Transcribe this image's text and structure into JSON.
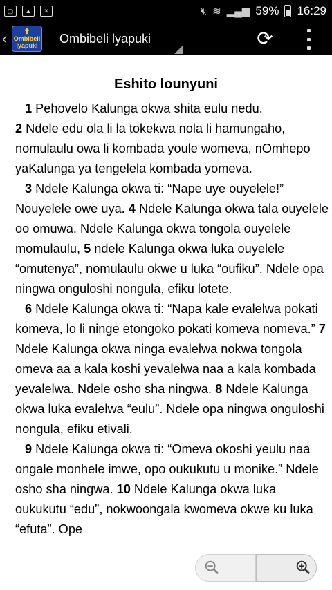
{
  "status_bar": {
    "battery": "59%",
    "time": "16:29"
  },
  "app_bar": {
    "logo_line1": "Ombibeli",
    "logo_line2": "lyapuki",
    "title": "Ombibeli lyapuki"
  },
  "chapter_title": "Eshito lounyuni",
  "paragraphs": [
    {
      "segments": [
        {
          "v": "1",
          "t": " Pehovelo Kalunga okwa shita eulu nedu."
        }
      ]
    },
    {
      "noindent": true,
      "segments": [
        {
          "v": "2",
          "t": " Ndele edu ola li la tokekwa nola li hamungaho, nomulaulu owa li kombada youle womeva, nOmhepo yaKalunga ya tengelela kombada yomeva."
        }
      ]
    },
    {
      "segments": [
        {
          "v": "3",
          "t": " Ndele Kalunga okwa ti: “Nape uye ouyelele!” Nouyelele owe uya. "
        },
        {
          "v": "4",
          "t": " Ndele Kalunga okwa tala ouyelele oo omuwa. Ndele Kalunga okwa tongola ouyelele momulaulu, "
        },
        {
          "v": "5",
          "t": " ndele Kalunga okwa luka ouyelele “omutenya”, nomulaulu okwe u luka “oufiku”. Ndele opa ningwa onguloshi nongula, efiku lotete."
        }
      ]
    },
    {
      "segments": [
        {
          "v": "6",
          "t": " Ndele Kalunga okwa ti: “Napa kale evalelwa pokati komeva, lo li ninge etongoko pokati komeva nomeva.” "
        },
        {
          "v": "7",
          "t": " Ndele Kalunga okwa ninga evalelwa nokwa tongola omeva aa a kala koshi yevalelwa naa a kala kombada yevalelwa. Ndele osho sha ningwa. "
        },
        {
          "v": "8",
          "t": " Ndele Kalunga okwa luka evalelwa “eulu”. Ndele opa ningwa onguloshi nongula, efiku etivali."
        }
      ]
    },
    {
      "segments": [
        {
          "v": "9",
          "t": " Ndele Kalunga okwa ti: “Omeva okoshi yeulu naa ongale monhele imwe, opo oukukutu u monike.” Ndele osho sha ningwa. "
        },
        {
          "v": "10",
          "t": " Ndele Kalunga okwa luka oukukutu “edu”, nokwoongala kwomeva okwe ku luka “efuta”. Ope"
        }
      ]
    }
  ]
}
